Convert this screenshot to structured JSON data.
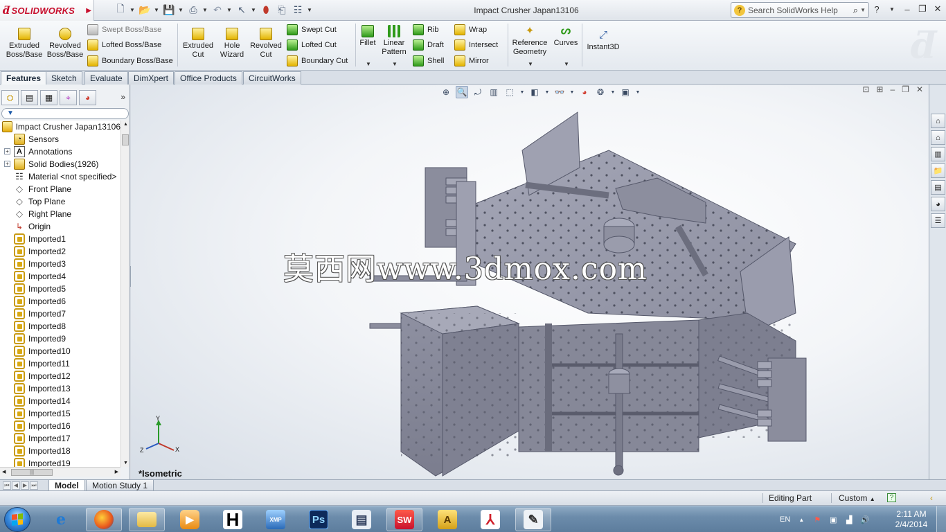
{
  "app": {
    "brand_logo_text": "SOLIDWORKS",
    "document_title": "Impact Crusher Japan13106"
  },
  "search": {
    "placeholder": "Search SolidWorks Help"
  },
  "command_manager": {
    "large_buttons": [
      {
        "label": "Extruded\nBoss/Base",
        "icon": "extruded-boss-icon"
      },
      {
        "label": "Revolved\nBoss/Base",
        "icon": "revolved-boss-icon"
      },
      {
        "label": "Extruded\nCut",
        "icon": "extruded-cut-icon"
      },
      {
        "label": "Hole\nWizard",
        "icon": "hole-wizard-icon"
      },
      {
        "label": "Revolved\nCut",
        "icon": "revolved-cut-icon"
      },
      {
        "label": "Fillet",
        "icon": "fillet-icon"
      },
      {
        "label": "Linear\nPattern",
        "icon": "linear-pattern-icon"
      },
      {
        "label": "Reference\nGeometry",
        "icon": "reference-geometry-icon"
      },
      {
        "label": "Curves",
        "icon": "curves-icon"
      },
      {
        "label": "Instant3D",
        "icon": "instant3d-icon"
      }
    ],
    "small_buttons": {
      "swept_boss": "Swept Boss/Base",
      "lofted_boss": "Lofted Boss/Base",
      "boundary_boss": "Boundary Boss/Base",
      "swept_cut": "Swept Cut",
      "lofted_cut": "Lofted Cut",
      "boundary_cut": "Boundary Cut",
      "rib": "Rib",
      "draft": "Draft",
      "shell": "Shell",
      "wrap": "Wrap",
      "intersect": "Intersect",
      "mirror": "Mirror"
    }
  },
  "tabs": [
    "Features",
    "Sketch",
    "Evaluate",
    "DimXpert",
    "Office Products",
    "CircuitWorks"
  ],
  "feature_tree": {
    "root": "Impact Crusher Japan13106",
    "items": [
      {
        "label": "Sensors",
        "icon": "sensors-icon",
        "expandable": false
      },
      {
        "label": "Annotations",
        "icon": "annotations-icon",
        "expandable": true
      },
      {
        "label": "Solid Bodies(1926)",
        "icon": "solid-bodies-icon",
        "expandable": true
      },
      {
        "label": "Material <not specified>",
        "icon": "material-icon",
        "expandable": false
      },
      {
        "label": "Front Plane",
        "icon": "plane-icon",
        "expandable": false
      },
      {
        "label": "Top Plane",
        "icon": "plane-icon",
        "expandable": false
      },
      {
        "label": "Right Plane",
        "icon": "plane-icon",
        "expandable": false
      },
      {
        "label": "Origin",
        "icon": "origin-icon",
        "expandable": false
      },
      {
        "label": "Imported1",
        "icon": "imported-body-icon",
        "expandable": false
      },
      {
        "label": "Imported2",
        "icon": "imported-body-icon",
        "expandable": false
      },
      {
        "label": "Imported3",
        "icon": "imported-body-icon",
        "expandable": false
      },
      {
        "label": "Imported4",
        "icon": "imported-body-icon",
        "expandable": false
      },
      {
        "label": "Imported5",
        "icon": "imported-body-icon",
        "expandable": false
      },
      {
        "label": "Imported6",
        "icon": "imported-body-icon",
        "expandable": false
      },
      {
        "label": "Imported7",
        "icon": "imported-body-icon",
        "expandable": false
      },
      {
        "label": "Imported8",
        "icon": "imported-body-icon",
        "expandable": false
      },
      {
        "label": "Imported9",
        "icon": "imported-body-icon",
        "expandable": false
      },
      {
        "label": "Imported10",
        "icon": "imported-body-icon",
        "expandable": false
      },
      {
        "label": "Imported11",
        "icon": "imported-body-icon",
        "expandable": false
      },
      {
        "label": "Imported12",
        "icon": "imported-body-icon",
        "expandable": false
      },
      {
        "label": "Imported13",
        "icon": "imported-body-icon",
        "expandable": false
      },
      {
        "label": "Imported14",
        "icon": "imported-body-icon",
        "expandable": false
      },
      {
        "label": "Imported15",
        "icon": "imported-body-icon",
        "expandable": false
      },
      {
        "label": "Imported16",
        "icon": "imported-body-icon",
        "expandable": false
      },
      {
        "label": "Imported17",
        "icon": "imported-body-icon",
        "expandable": false
      },
      {
        "label": "Imported18",
        "icon": "imported-body-icon",
        "expandable": false
      },
      {
        "label": "Imported19",
        "icon": "imported-body-icon",
        "expandable": false
      }
    ]
  },
  "graphics": {
    "view_name": "*Isometric",
    "watermark_text": "莫西网www.3dmox.com",
    "triad_labels": {
      "x": "X",
      "y": "Y",
      "z": "Z"
    }
  },
  "model_tabs": [
    "Model",
    "Motion Study 1"
  ],
  "status_bar": {
    "mode": "Editing Part",
    "units": "Custom",
    "help_glyph": "?"
  },
  "taskbar": {
    "apps": [
      "internet-explorer-icon",
      "firefox-icon",
      "file-explorer-icon",
      "media-player-icon",
      "h-app-icon",
      "xmp-app-icon",
      "photoshop-icon",
      "document-app-icon",
      "solidworks-icon",
      "autocad-icon",
      "acrobat-icon",
      "drawing-app-icon"
    ],
    "ps_label": "Ps",
    "sw_label": "SW",
    "h_label": "H",
    "language": "EN",
    "time": "2:11 AM",
    "date": "2/4/2014"
  },
  "colors": {
    "brand_red": "#c8102e",
    "model_gray": "#8a8c9c",
    "ui_blue_gray": "#d9dfe7"
  }
}
